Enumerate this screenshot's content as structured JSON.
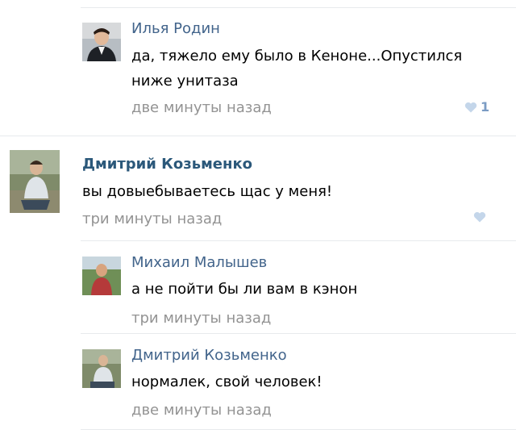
{
  "colors": {
    "author_link": "#42648b",
    "author_bold": "#2b587a",
    "timestamp": "#939393",
    "like_heart": "#c4d6ea",
    "like_count": "#7b9cc4",
    "separator": "#e7eaed"
  },
  "comments": [
    {
      "author": "Илья Родин",
      "text_lines": [
        "да, тяжело ему было в Кеноне...Опустился",
        "ниже унитаза"
      ],
      "time": "две минуты назад",
      "likes": "1",
      "avatar_icon": "user-photo-suit"
    },
    {
      "author": "Дмитрий Козьменко",
      "text_lines": [
        "вы довыебываетесь щас у меня!"
      ],
      "time": "три минуты назад",
      "likes": "",
      "avatar_icon": "user-photo-outdoor"
    },
    {
      "author": "Михаил Малышев",
      "text_lines": [
        "а не пойти бы ли вам в кэнон"
      ],
      "time": "три минуты назад",
      "likes": "",
      "avatar_icon": "user-photo-outdoor-green"
    },
    {
      "author": "Дмитрий Козьменко",
      "text_lines": [
        "нормалек, свой человек!"
      ],
      "time": "две минуты назад",
      "likes": "",
      "avatar_icon": "user-photo-outdoor"
    }
  ]
}
